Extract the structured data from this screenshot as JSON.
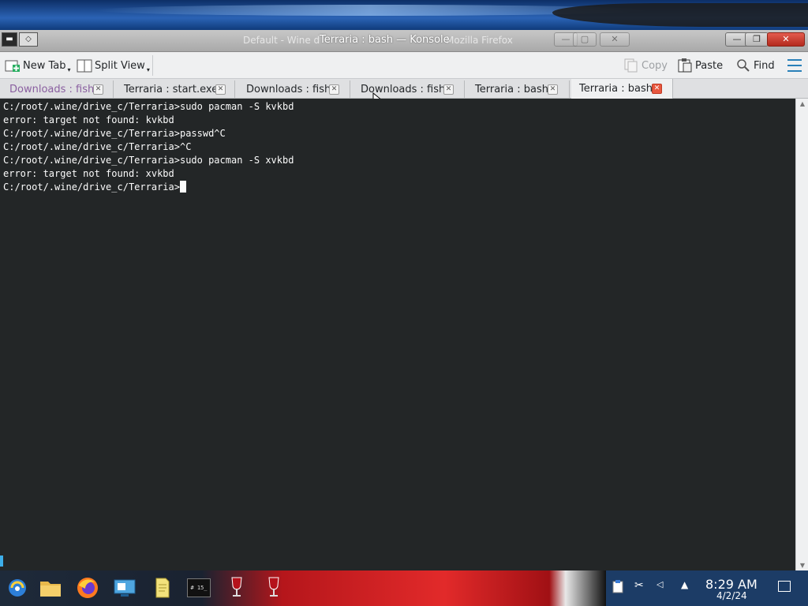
{
  "window": {
    "title": "Terraria : bash — Konsole",
    "ghost_title_left": "Default - Wine d",
    "ghost_title_right": "Mozilla Firefox"
  },
  "toolbar": {
    "new_tab": "New Tab",
    "split_view": "Split View",
    "copy": "Copy",
    "paste": "Paste",
    "find": "Find"
  },
  "tabs": [
    {
      "label": "Downloads : fish"
    },
    {
      "label": "Terraria : start.exe"
    },
    {
      "label": "Downloads : fish"
    },
    {
      "label": "Downloads : fish"
    },
    {
      "label": "Terraria : bash"
    },
    {
      "label": "Terraria : bash"
    }
  ],
  "terminal": {
    "lines": [
      "C:/root/.wine/drive_c/Terraria>sudo pacman -S kvkbd",
      "error: target not found: kvkbd",
      "C:/root/.wine/drive_c/Terraria>passwd^C",
      "C:/root/.wine/drive_c/Terraria>^C",
      "C:/root/.wine/drive_c/Terraria>sudo pacman -S xvkbd",
      "error: target not found: xvkbd",
      "C:/root/.wine/drive_c/Terraria>"
    ]
  },
  "taskbar": {
    "time": "8:29 AM",
    "date": "4/2/24",
    "terminal_icon_text": "# 15_"
  },
  "colors": {
    "terminal_bg": "#232627",
    "terminal_fg": "#fcfcfc",
    "active_tab_close": "#e8573f",
    "accent": "#2980b9"
  }
}
